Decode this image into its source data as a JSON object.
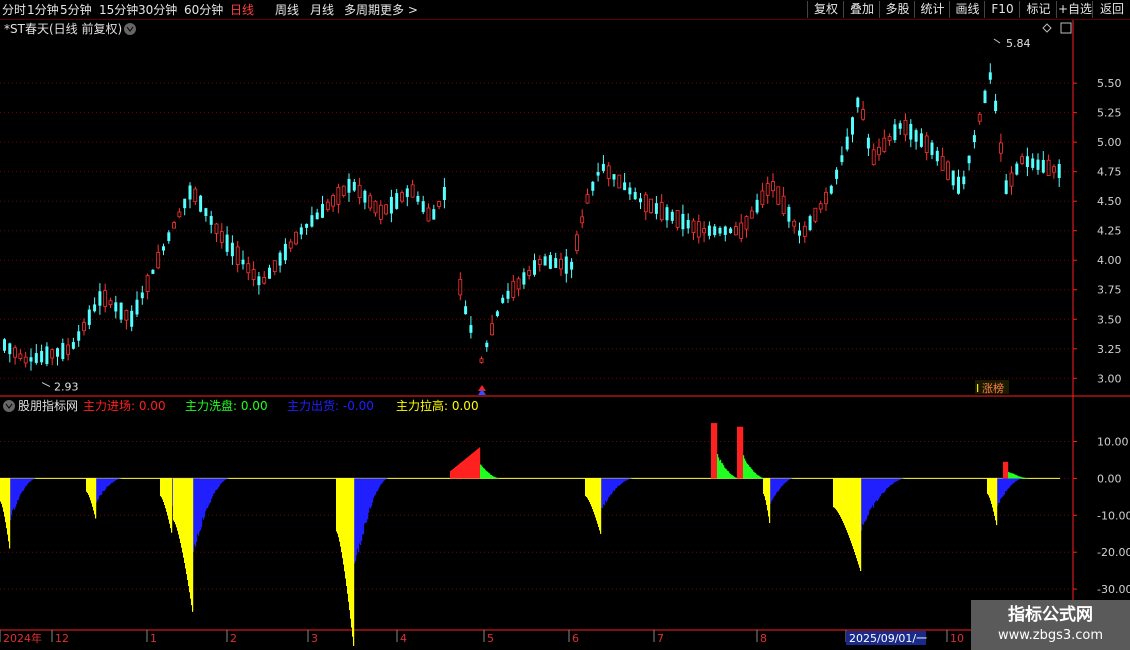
{
  "toolbar": {
    "periods": [
      "分时",
      "1分钟",
      "5分钟",
      "15分钟",
      "30分钟",
      "60分钟",
      "日线",
      "周线",
      "月线",
      "多周期",
      "更多 >"
    ],
    "active_period": "日线",
    "actions": [
      "复权",
      "叠加",
      "多股",
      "统计",
      "画线",
      "F10",
      "标记",
      "+自选",
      "返回"
    ]
  },
  "main_chart": {
    "title": "*ST春天(日线 前复权)",
    "y_ticks": [
      "5.50",
      "5.25",
      "5.00",
      "4.75",
      "4.50",
      "4.25",
      "4.00",
      "3.75",
      "3.50",
      "3.25",
      "3.00"
    ],
    "high_label": "5.84",
    "low_label": "2.93",
    "tag": "涨榜",
    "tag_prefix": "I"
  },
  "indicator": {
    "name": "股朋指标网",
    "legend": [
      {
        "label": "主力进场:",
        "value": "0.00",
        "color": "#ff2020"
      },
      {
        "label": "主力洗盘:",
        "value": "0.00",
        "color": "#20ff20"
      },
      {
        "label": "主力出货:",
        "value": "-0.00",
        "color": "#2020ff"
      },
      {
        "label": "主力拉高:",
        "value": "0.00",
        "color": "#ffff00"
      }
    ],
    "y_ticks": [
      "10.00",
      "0.00",
      "-10.00",
      "-20.00",
      "-30.00"
    ]
  },
  "time_axis": {
    "labels": [
      "2024年",
      "12",
      "1",
      "2",
      "3",
      "4",
      "5",
      "6",
      "7",
      "8",
      "2025/09/01/一",
      "10"
    ]
  },
  "watermark": {
    "title": "指标公式网",
    "url": "www.zbgs3.com"
  },
  "colors": {
    "up": "#ff3232",
    "down": "#54ffff",
    "grid": "#7a0000",
    "axis": "#ff2020"
  },
  "chart_data": {
    "type": "candlestick",
    "ylim": [
      2.85,
      5.95
    ],
    "indicator_ylim": [
      -40,
      18
    ],
    "series": [
      {
        "name": "主力进场",
        "color": "#ff2020"
      },
      {
        "name": "主力洗盘",
        "color": "#20ff20"
      },
      {
        "name": "主力出货",
        "color": "#2020ff"
      },
      {
        "name": "主力拉高",
        "color": "#ffff00"
      }
    ]
  }
}
